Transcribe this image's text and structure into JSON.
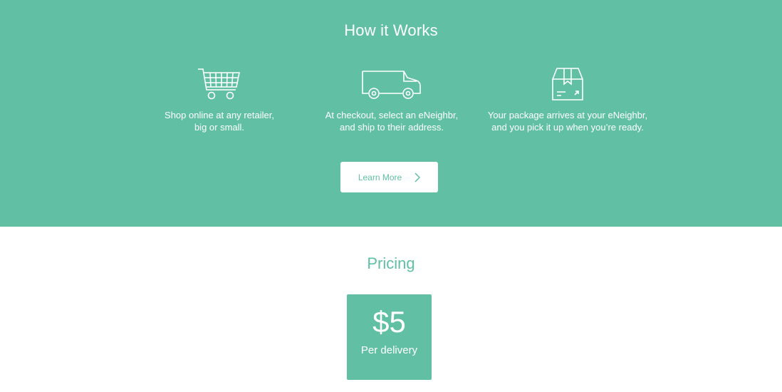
{
  "how_it_works": {
    "title": "How it Works",
    "steps": [
      {
        "icon": "shopping-cart-icon",
        "text": "Shop online at any retailer,\nbig or small."
      },
      {
        "icon": "delivery-truck-icon",
        "text": "At checkout, select an eNeighbr,\nand ship to their address."
      },
      {
        "icon": "package-box-icon",
        "text": "Your package arrives at your eNeighbr,\nand you pick it up when you’re ready."
      }
    ],
    "button_label": "Learn More"
  },
  "pricing": {
    "title": "Pricing",
    "amount": "$5",
    "label": "Per delivery"
  },
  "colors": {
    "accent": "#61c0a3",
    "text_on_accent": "#ffffff",
    "background": "#ffffff"
  }
}
